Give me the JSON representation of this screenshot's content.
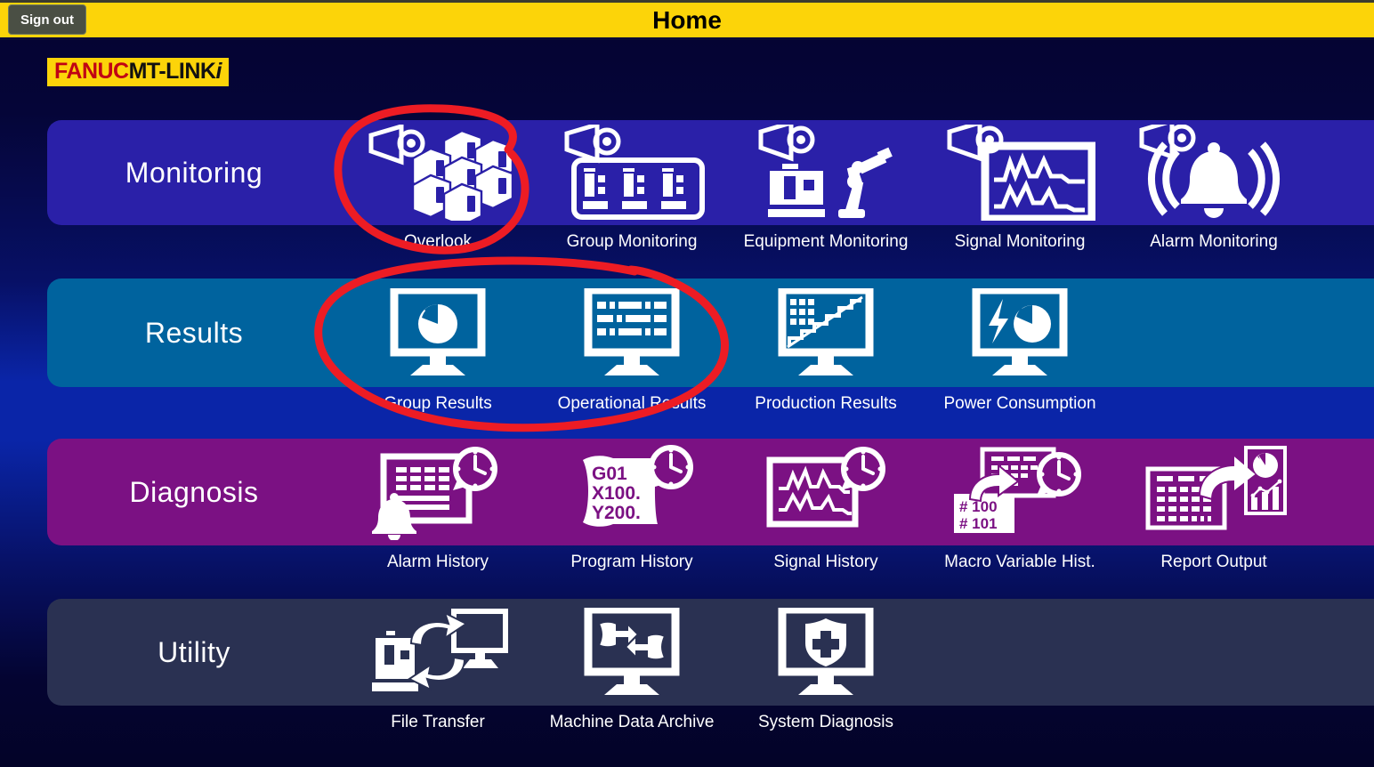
{
  "header": {
    "title": "Home",
    "signout_label": "Sign out",
    "bar_color": "#FCD409"
  },
  "logo": {
    "brand": "FANUC",
    "product": "MT-LINK",
    "suffix": "i",
    "brand_color": "#C00014",
    "background": "#FCD409"
  },
  "categories": [
    {
      "name": "Monitoring",
      "color": "#2A20A8",
      "tiles": [
        {
          "label": "Overlook",
          "icon": "eye-machines-icon"
        },
        {
          "label": "Group Monitoring",
          "icon": "eye-machine-group-icon"
        },
        {
          "label": "Equipment Monitoring",
          "icon": "eye-machine-robot-icon"
        },
        {
          "label": "Signal Monitoring",
          "icon": "eye-waveform-screen-icon"
        },
        {
          "label": "Alarm Monitoring",
          "icon": "eye-ringing-bell-icon"
        }
      ]
    },
    {
      "name": "Results",
      "color": "#00639E",
      "tiles": [
        {
          "label": "Group Results",
          "icon": "monitor-pie-chart-icon"
        },
        {
          "label": "Operational Results",
          "icon": "monitor-table-icon"
        },
        {
          "label": "Production Results",
          "icon": "monitor-stair-chart-icon"
        },
        {
          "label": "Power Consumption",
          "icon": "monitor-bolt-pie-icon"
        }
      ]
    },
    {
      "name": "Diagnosis",
      "color": "#7B1183",
      "tiles": [
        {
          "label": "Alarm History",
          "icon": "bell-table-clock-icon"
        },
        {
          "label": "Program History",
          "icon": "gcode-paper-clock-icon",
          "text_lines": [
            "G01",
            "X100.",
            "Y200."
          ]
        },
        {
          "label": "Signal History",
          "icon": "waveform-clock-icon"
        },
        {
          "label": "Macro Variable Hist.",
          "icon": "macro-variable-clock-icon",
          "text_lines": [
            "# 100",
            "# 101"
          ]
        },
        {
          "label": "Report Output",
          "icon": "table-to-report-icon"
        }
      ]
    },
    {
      "name": "Utility",
      "color": "#2A3152",
      "tiles": [
        {
          "label": "File Transfer",
          "icon": "machine-pc-sync-icon"
        },
        {
          "label": "Machine Data Archive",
          "icon": "monitor-data-exchange-icon"
        },
        {
          "label": "System Diagnosis",
          "icon": "monitor-shield-plus-icon"
        }
      ]
    }
  ],
  "annotations": {
    "ink_color": "#ED1C24",
    "marks": [
      {
        "name": "overlook-circle",
        "shape": "hand-drawn-ellipse",
        "targets": [
          "Overlook"
        ]
      },
      {
        "name": "results-pair-circle",
        "shape": "hand-drawn-ellipse",
        "targets": [
          "Group Results",
          "Operational Results"
        ]
      }
    ]
  }
}
